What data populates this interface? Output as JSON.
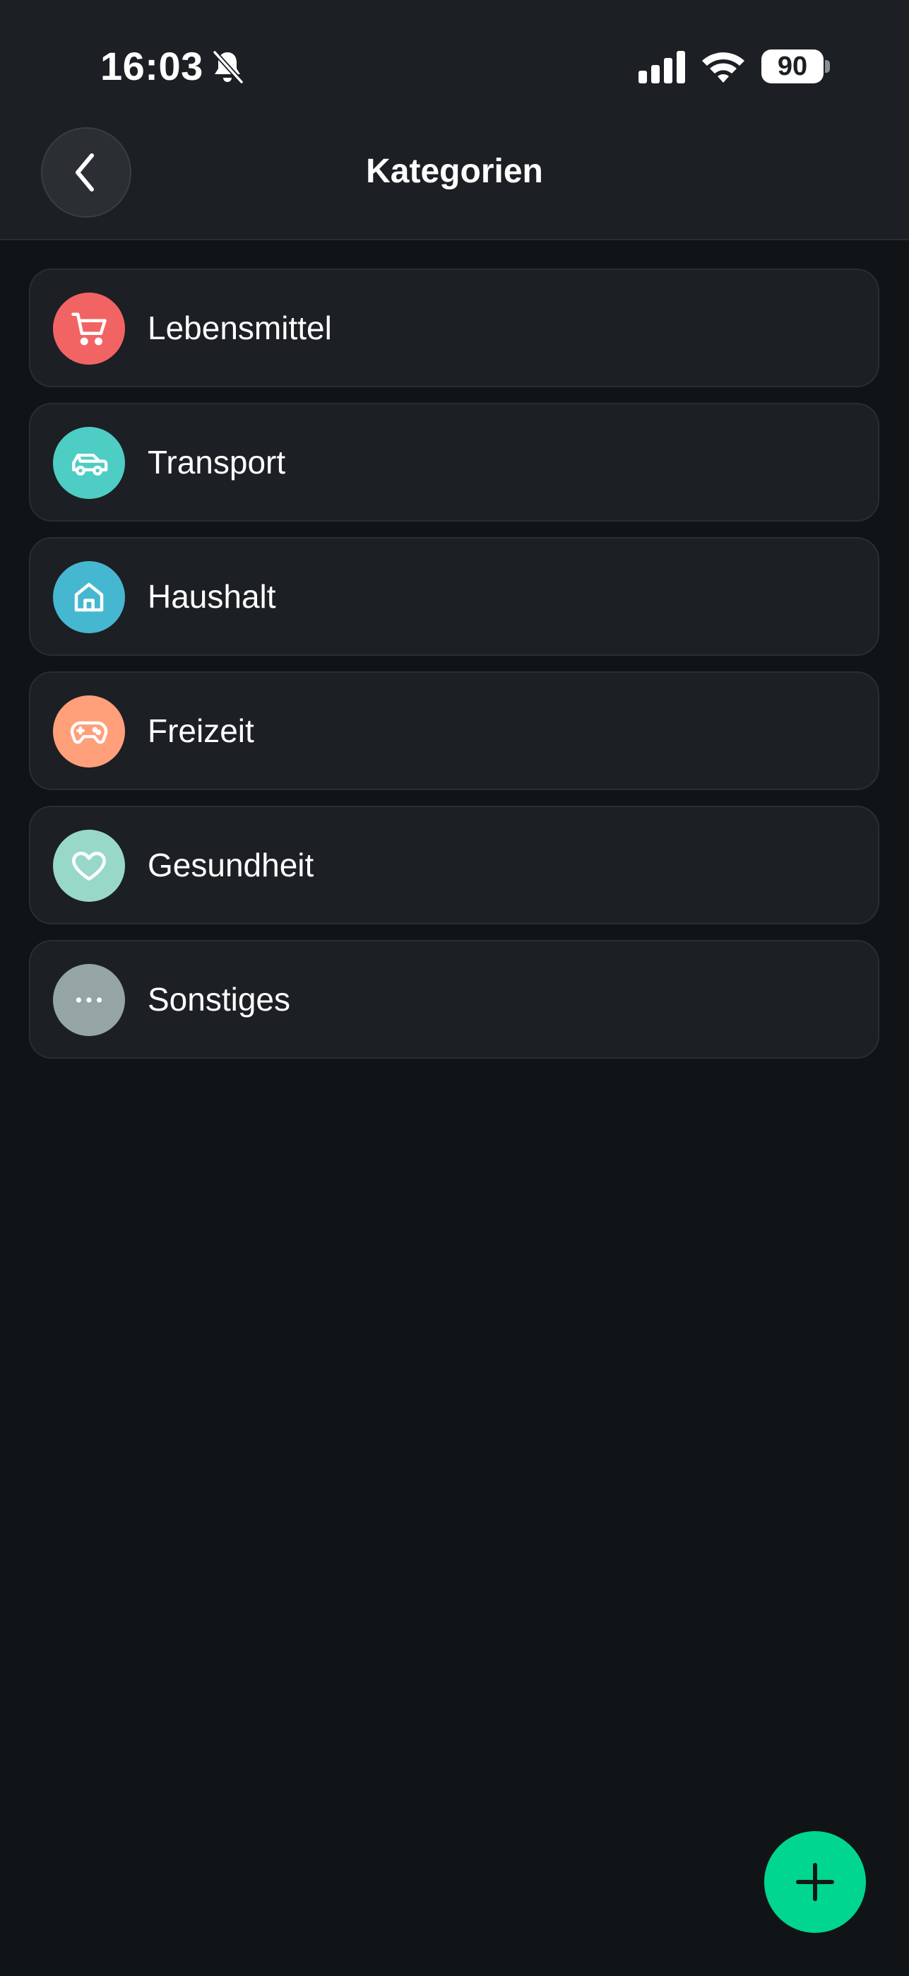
{
  "status_bar": {
    "time": "16:03",
    "battery_level": "90",
    "icons": [
      "bell-off-icon",
      "cellular-signal-icon",
      "wifi-icon",
      "battery-icon"
    ]
  },
  "nav": {
    "title": "Kategorien",
    "back_icon": "chevron-left-icon"
  },
  "categories": [
    {
      "label": "Lebensmittel",
      "icon": "shopping-cart-icon",
      "color": "#f26464"
    },
    {
      "label": "Transport",
      "icon": "car-icon",
      "color": "#4ecdc4"
    },
    {
      "label": "Haushalt",
      "icon": "home-icon",
      "color": "#45b7d1"
    },
    {
      "label": "Freizeit",
      "icon": "gamepad-icon",
      "color": "#ffa07a"
    },
    {
      "label": "Gesundheit",
      "icon": "heart-icon",
      "color": "#98d8c8"
    },
    {
      "label": "Sonstiges",
      "icon": "more-horizontal-icon",
      "color": "#95a5a6"
    }
  ],
  "fab": {
    "icon": "plus-icon",
    "color": "#00d68f"
  },
  "colors": {
    "background": "#111417",
    "surface": "#1c1f23",
    "border": "#2a2d31",
    "text": "#ffffff"
  }
}
